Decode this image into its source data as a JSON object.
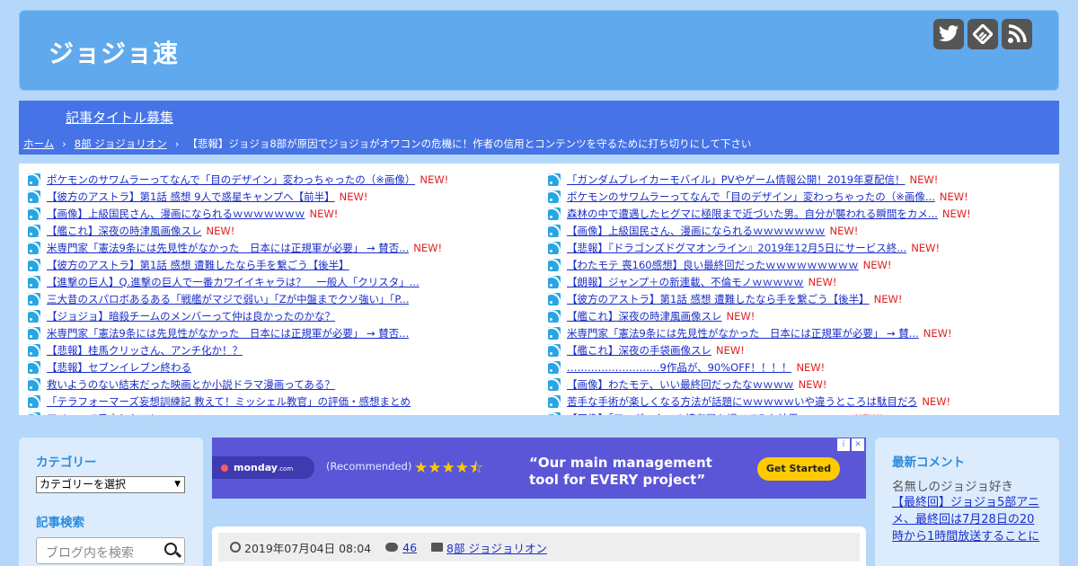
{
  "header": {
    "site_title": "ジョジョ速",
    "social": [
      {
        "icon": "twitter-icon"
      },
      {
        "icon": "feedly-icon"
      },
      {
        "icon": "rss-icon"
      }
    ]
  },
  "nav": {
    "recruit": "記事タイトル募集",
    "breadcrumb": {
      "home": "ホーム",
      "category": "8部 ジョジョリオン",
      "current": "【悲報】ジョジョ8部が原因でジョジョがオワコンの危機に！作者の信用とコンテンツを守るために打ち切りにして下さい"
    }
  },
  "feed": {
    "new_label": "NEW!",
    "left": [
      {
        "title": "ポケモンのサワムラーってなんで「目のデザイン」変わっちゃったの（※画像）",
        "new": true
      },
      {
        "title": "【彼方のアストラ】第1話 感想 9人で惑星キャンプへ【前半】",
        "new": true
      },
      {
        "title": "【画像】上級国民さん、漫画になられるｗｗｗｗｗｗｗ",
        "new": true
      },
      {
        "title": "【艦これ】深夜の時津風画像スレ",
        "new": true
      },
      {
        "title": "米専門家「憲法9条には先見性がなかった　日本には正規軍が必要」 → 賛否...",
        "new": true
      },
      {
        "title": "【彼方のアストラ】第1話 感想 遭難したなら手を繋ごう【後半】",
        "new": false
      },
      {
        "title": "【進撃の巨人】Q.進撃の巨人で一番カワイイキャラは？　一般人「クリスタ」...",
        "new": false
      },
      {
        "title": "三大昔のスパロボあるある「戦艦がマジで弱い」「Zが中盤までクソ強い」「P...",
        "new": false
      },
      {
        "title": "【ジョジョ】暗殺チームのメンバーって仲は良かったのかな？",
        "new": false
      },
      {
        "title": "米専門家「憲法9条には先見性がなかった　日本には正規軍が必要」 → 賛否...",
        "new": false
      },
      {
        "title": "【悲報】桂馬クリッさん、アンチ化か！？",
        "new": false
      },
      {
        "title": "【悲報】セブンイレブン終わる",
        "new": false
      },
      {
        "title": "救いようのない結末だった映画とか小説ドラマ漫画ってある？",
        "new": false
      },
      {
        "title": "「テラフォーマーズ妄想訓練記 教えて！ミッシェル教官」の評価・感想まとめ",
        "new": false
      },
      {
        "title": "アイコンで予言したこと",
        "new": false
      }
    ],
    "right": [
      {
        "title": "「ガンダムブレイカーモバイル」PVやゲーム情報公開！2019年夏配信！",
        "new": true
      },
      {
        "title": "ポケモンのサワムラーってなんで「目のデザイン」変わっちゃったの（※画像...",
        "new": true
      },
      {
        "title": "森林の中で遭遇したヒグマに極限まで近づいた男。自分が襲われる瞬間をカメ...",
        "new": true
      },
      {
        "title": "【画像】上級国民さん、漫画になられるｗｗｗｗｗｗｗ",
        "new": true
      },
      {
        "title": "【悲報】『ドラゴンズドグマオンライン』2019年12月5日にサービス終...",
        "new": true
      },
      {
        "title": "【わたモテ 喪160感想】良い最終回だったｗｗｗｗｗｗｗｗｗ",
        "new": true
      },
      {
        "title": "【朗報】ジャンプ＋の新連載、不倫モノｗｗｗｗｗ",
        "new": true
      },
      {
        "title": "【彼方のアストラ】第1話 感想 遭難したなら手を繋ごう【後半】",
        "new": true
      },
      {
        "title": "【艦これ】深夜の時津風画像スレ",
        "new": true
      },
      {
        "title": "米専門家「憲法9条には先見性がなかった　日本には正規軍が必要」 → 賛...",
        "new": true
      },
      {
        "title": "【艦これ】深夜の手袋画像スレ",
        "new": true
      },
      {
        "title": "………………………9作品が、90%OFF！！！！",
        "new": true
      },
      {
        "title": "【画像】わたモテ、いい最終回だったなｗｗｗｗ",
        "new": true
      },
      {
        "title": "苦手な手術が楽しくなる方法が話題にｗｗｗｗｗいや違うところは駄目だろ",
        "new": true
      },
      {
        "title": "【画像】「アンダーク」の読者層を調べてみた結果ｗｗｗｗｗ",
        "new": true
      }
    ]
  },
  "sidebar_left": {
    "category_heading": "カテゴリー",
    "category_select": "カテゴリーを選択",
    "search_heading": "記事検索",
    "search_placeholder": "ブログ内を検索"
  },
  "ad": {
    "brand": "monday",
    "brand_suffix": ".com",
    "recommended": "(Recommended)",
    "rating_stars": 4.5,
    "headline_line1": "“Our main management",
    "headline_line2": "tool for EVERY project”",
    "cta": "Get Started",
    "colors": {
      "background": "#5a56d7",
      "cta": "#ffcb00"
    }
  },
  "post": {
    "date": "2019年07月04日 08:04",
    "comment_count": "46",
    "category": "8部 ジョジョリオン"
  },
  "sidebar_right": {
    "heading": "最新コメント",
    "commenter": "名無しのジョジョ好き",
    "comment_link": "【最終回】ジョジョ5部アニメ、最終回は7月28日の20時から1時間放送することに"
  },
  "colors": {
    "background": "#b5d8fa",
    "header": "#5fa9ec",
    "navbar": "#4674e6",
    "link": "#1b2ec9",
    "new_badge": "#e02020",
    "sidebar_heading": "#2a8bdd"
  }
}
